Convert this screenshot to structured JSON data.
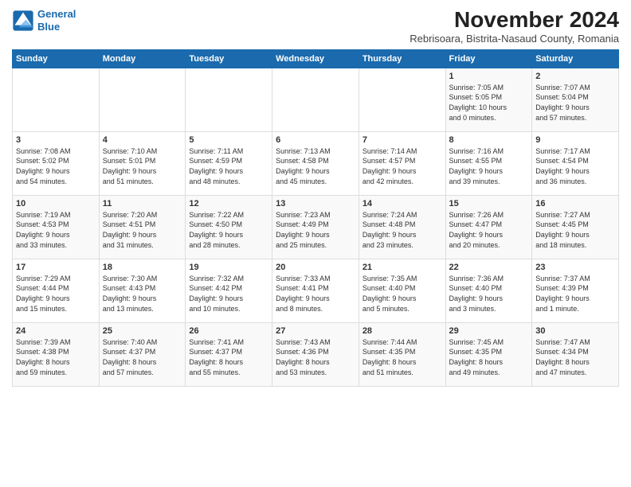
{
  "header": {
    "logo_line1": "General",
    "logo_line2": "Blue",
    "main_title": "November 2024",
    "subtitle": "Rebrisoara, Bistrita-Nasaud County, Romania"
  },
  "days_of_week": [
    "Sunday",
    "Monday",
    "Tuesday",
    "Wednesday",
    "Thursday",
    "Friday",
    "Saturday"
  ],
  "weeks": [
    [
      {
        "day": "",
        "detail": ""
      },
      {
        "day": "",
        "detail": ""
      },
      {
        "day": "",
        "detail": ""
      },
      {
        "day": "",
        "detail": ""
      },
      {
        "day": "",
        "detail": ""
      },
      {
        "day": "1",
        "detail": "Sunrise: 7:05 AM\nSunset: 5:05 PM\nDaylight: 10 hours\nand 0 minutes."
      },
      {
        "day": "2",
        "detail": "Sunrise: 7:07 AM\nSunset: 5:04 PM\nDaylight: 9 hours\nand 57 minutes."
      }
    ],
    [
      {
        "day": "3",
        "detail": "Sunrise: 7:08 AM\nSunset: 5:02 PM\nDaylight: 9 hours\nand 54 minutes."
      },
      {
        "day": "4",
        "detail": "Sunrise: 7:10 AM\nSunset: 5:01 PM\nDaylight: 9 hours\nand 51 minutes."
      },
      {
        "day": "5",
        "detail": "Sunrise: 7:11 AM\nSunset: 4:59 PM\nDaylight: 9 hours\nand 48 minutes."
      },
      {
        "day": "6",
        "detail": "Sunrise: 7:13 AM\nSunset: 4:58 PM\nDaylight: 9 hours\nand 45 minutes."
      },
      {
        "day": "7",
        "detail": "Sunrise: 7:14 AM\nSunset: 4:57 PM\nDaylight: 9 hours\nand 42 minutes."
      },
      {
        "day": "8",
        "detail": "Sunrise: 7:16 AM\nSunset: 4:55 PM\nDaylight: 9 hours\nand 39 minutes."
      },
      {
        "day": "9",
        "detail": "Sunrise: 7:17 AM\nSunset: 4:54 PM\nDaylight: 9 hours\nand 36 minutes."
      }
    ],
    [
      {
        "day": "10",
        "detail": "Sunrise: 7:19 AM\nSunset: 4:53 PM\nDaylight: 9 hours\nand 33 minutes."
      },
      {
        "day": "11",
        "detail": "Sunrise: 7:20 AM\nSunset: 4:51 PM\nDaylight: 9 hours\nand 31 minutes."
      },
      {
        "day": "12",
        "detail": "Sunrise: 7:22 AM\nSunset: 4:50 PM\nDaylight: 9 hours\nand 28 minutes."
      },
      {
        "day": "13",
        "detail": "Sunrise: 7:23 AM\nSunset: 4:49 PM\nDaylight: 9 hours\nand 25 minutes."
      },
      {
        "day": "14",
        "detail": "Sunrise: 7:24 AM\nSunset: 4:48 PM\nDaylight: 9 hours\nand 23 minutes."
      },
      {
        "day": "15",
        "detail": "Sunrise: 7:26 AM\nSunset: 4:47 PM\nDaylight: 9 hours\nand 20 minutes."
      },
      {
        "day": "16",
        "detail": "Sunrise: 7:27 AM\nSunset: 4:45 PM\nDaylight: 9 hours\nand 18 minutes."
      }
    ],
    [
      {
        "day": "17",
        "detail": "Sunrise: 7:29 AM\nSunset: 4:44 PM\nDaylight: 9 hours\nand 15 minutes."
      },
      {
        "day": "18",
        "detail": "Sunrise: 7:30 AM\nSunset: 4:43 PM\nDaylight: 9 hours\nand 13 minutes."
      },
      {
        "day": "19",
        "detail": "Sunrise: 7:32 AM\nSunset: 4:42 PM\nDaylight: 9 hours\nand 10 minutes."
      },
      {
        "day": "20",
        "detail": "Sunrise: 7:33 AM\nSunset: 4:41 PM\nDaylight: 9 hours\nand 8 minutes."
      },
      {
        "day": "21",
        "detail": "Sunrise: 7:35 AM\nSunset: 4:40 PM\nDaylight: 9 hours\nand 5 minutes."
      },
      {
        "day": "22",
        "detail": "Sunrise: 7:36 AM\nSunset: 4:40 PM\nDaylight: 9 hours\nand 3 minutes."
      },
      {
        "day": "23",
        "detail": "Sunrise: 7:37 AM\nSunset: 4:39 PM\nDaylight: 9 hours\nand 1 minute."
      }
    ],
    [
      {
        "day": "24",
        "detail": "Sunrise: 7:39 AM\nSunset: 4:38 PM\nDaylight: 8 hours\nand 59 minutes."
      },
      {
        "day": "25",
        "detail": "Sunrise: 7:40 AM\nSunset: 4:37 PM\nDaylight: 8 hours\nand 57 minutes."
      },
      {
        "day": "26",
        "detail": "Sunrise: 7:41 AM\nSunset: 4:37 PM\nDaylight: 8 hours\nand 55 minutes."
      },
      {
        "day": "27",
        "detail": "Sunrise: 7:43 AM\nSunset: 4:36 PM\nDaylight: 8 hours\nand 53 minutes."
      },
      {
        "day": "28",
        "detail": "Sunrise: 7:44 AM\nSunset: 4:35 PM\nDaylight: 8 hours\nand 51 minutes."
      },
      {
        "day": "29",
        "detail": "Sunrise: 7:45 AM\nSunset: 4:35 PM\nDaylight: 8 hours\nand 49 minutes."
      },
      {
        "day": "30",
        "detail": "Sunrise: 7:47 AM\nSunset: 4:34 PM\nDaylight: 8 hours\nand 47 minutes."
      }
    ]
  ]
}
